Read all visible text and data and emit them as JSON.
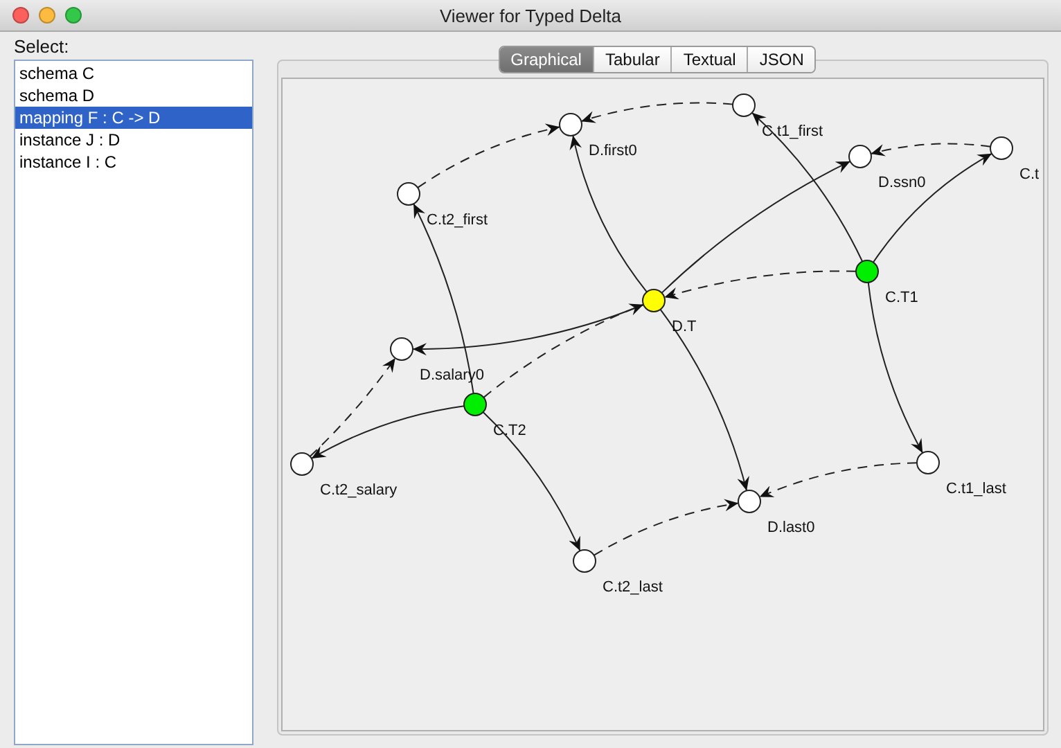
{
  "window": {
    "title": "Viewer for Typed Delta"
  },
  "sidebar": {
    "label": "Select:",
    "items": [
      {
        "label": "schema C",
        "selected": false
      },
      {
        "label": "schema D",
        "selected": false
      },
      {
        "label": "mapping F : C -> D",
        "selected": true
      },
      {
        "label": "instance J : D",
        "selected": false
      },
      {
        "label": "instance I : C",
        "selected": false
      }
    ]
  },
  "tabs": [
    {
      "label": "Graphical",
      "selected": true
    },
    {
      "label": "Tabular",
      "selected": false
    },
    {
      "label": "Textual",
      "selected": false
    },
    {
      "label": "JSON",
      "selected": false
    }
  ],
  "graph": {
    "nodes": [
      {
        "label": "D.first0",
        "color": "#ffffff"
      },
      {
        "label": "C.t1_first",
        "color": "#ffffff"
      },
      {
        "label": "D.ssn0",
        "color": "#ffffff"
      },
      {
        "label": "C.t",
        "color": "#ffffff"
      },
      {
        "label": "C.t2_first",
        "color": "#ffffff"
      },
      {
        "label": "C.T1",
        "color": "#00ee00"
      },
      {
        "label": "D.T",
        "color": "#ffff00"
      },
      {
        "label": "D.salary0",
        "color": "#ffffff"
      },
      {
        "label": "C.T2",
        "color": "#00ee00"
      },
      {
        "label": "C.t2_salary",
        "color": "#ffffff"
      },
      {
        "label": "C.t1_last",
        "color": "#ffffff"
      },
      {
        "label": "D.last0",
        "color": "#ffffff"
      },
      {
        "label": "C.t2_last",
        "color": "#ffffff"
      }
    ]
  }
}
